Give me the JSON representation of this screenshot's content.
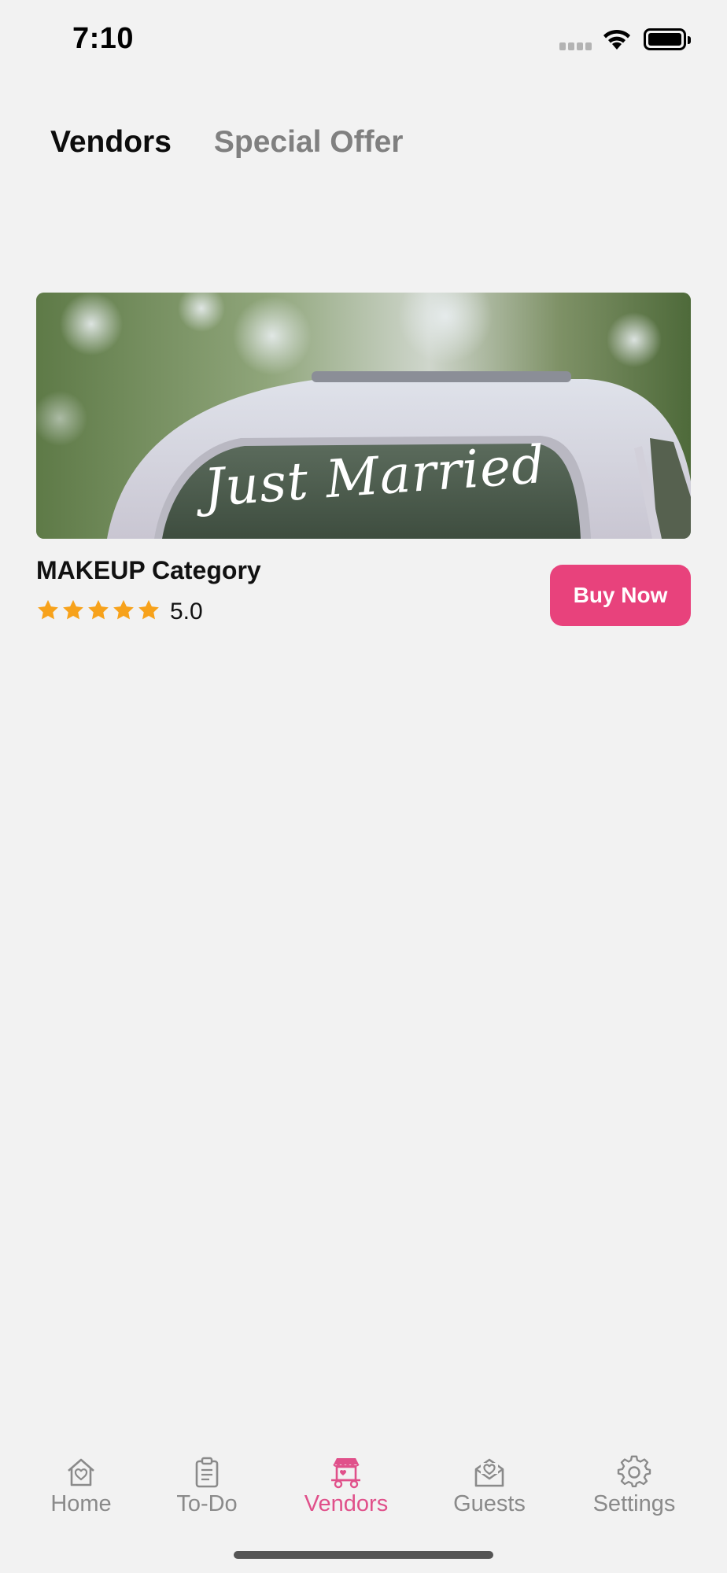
{
  "status_bar": {
    "time": "7:10"
  },
  "top_tabs": [
    {
      "label": "Vendors",
      "active": true
    },
    {
      "label": "Special Offer",
      "active": false
    }
  ],
  "card": {
    "image_text": "Just Married",
    "title": "MAKEUP Category",
    "rating": {
      "stars": 5,
      "max": 5,
      "value": "5.0",
      "star_color": "#f7a21b"
    },
    "buy_label": "Buy Now",
    "button_color": "#e8427c"
  },
  "bottom_nav": [
    {
      "label": "Home",
      "icon": "home-heart-icon",
      "active": false
    },
    {
      "label": "To-Do",
      "icon": "clipboard-icon",
      "active": false
    },
    {
      "label": "Vendors",
      "icon": "vendor-cart-icon",
      "active": true
    },
    {
      "label": "Guests",
      "icon": "envelope-heart-icon",
      "active": false
    },
    {
      "label": "Settings",
      "icon": "gear-icon",
      "active": false
    }
  ],
  "colors": {
    "accent": "#e8427c",
    "nav_active": "#e0508a",
    "nav_inactive": "#8a8a8a",
    "background": "#f2f2f2"
  }
}
